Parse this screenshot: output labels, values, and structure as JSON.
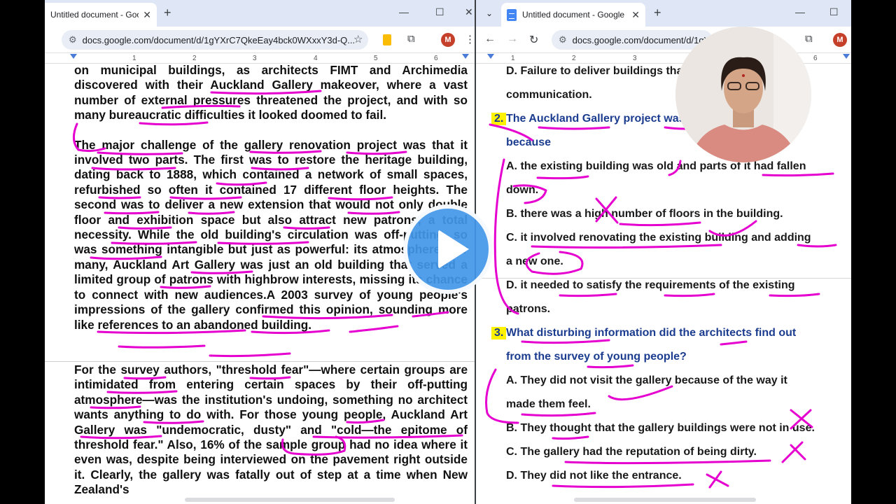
{
  "left_window": {
    "tab_title": "Untitled document - Google Docs",
    "url": "docs.google.com/document/d/1gYXrC7QkeEay4bck0WXxxY3d-Q...",
    "avatar_letter": "M",
    "ruler_numbers": [
      "1",
      "2",
      "3",
      "4",
      "5",
      "6"
    ],
    "para1": "on municipal buildings, as architects FIMT and Archimedia discovered with their Auckland Gallery makeover, where a vast number of external pressures threatened the project, and with so many bureaucratic difficulties it looked doomed to fail.",
    "para2": "The major challenge of the gallery renovation project was that it involved two parts. The first was to restore the heritage building, dating back to 1888, which contained a network of small spaces, refurbished so often it contained 17 different floor heights. The second was to deliver a new extension that would not only double floor and exhibition space but also attract new patrons, a total necessity. While the old building's circulation was off-putting, so was something intangible but just as powerful: its atmosphere. For many, Auckland Art Gallery was just an old building that served a limited group of patrons with highbrow interests, missing its chance to connect with new audiences.A 2003 survey of young people's impressions of the gallery confirmed this opinion, sounding more like references to an abandoned building.",
    "para3": "For the survey authors, \"threshold fear\"—where certain groups are intimidated from entering certain spaces by their off-putting atmosphere—was the institution's undoing, something no architect wants anything to do with. For those young people, Auckland Art Gallery was \"undemocratic, dusty\" and \"cold—the epitome of threshold fear.\" Also, 16% of the sample group had no idea where it even was, despite being interviewed on the pavement right outside it. Clearly, the gallery was fatally out of step at a time when New Zealand's"
  },
  "right_window": {
    "tab_title": "Untitled document - Google Docs",
    "url": "docs.google.com/document/d/1gY...",
    "avatar_letter": "M",
    "ruler_numbers": [
      "1",
      "2",
      "3",
      "6"
    ],
    "prev_option_line1": "D. Failure to deliver buildings that allow effective",
    "prev_option_line2": "communication.",
    "q2_num": "2.",
    "q2_line1": "The Auckland Gallery project was difficult",
    "q2_line2": "because",
    "q2_a1": "A. the existing building was old and parts of it had fallen",
    "q2_a2": "down.",
    "q2_b": "B. there was a high number of floors in the building.",
    "q2_c1": "C. it involved renovating the existing building and adding",
    "q2_c2": "a new one.",
    "q2_d1": "D. it needed to satisfy the requirements of the existing",
    "q2_d2": "patrons.",
    "q3_num": "3.",
    "q3_line1": "What disturbing information did the architects find out",
    "q3_line2": "from the survey of young people?",
    "q3_a1": "A. They did not visit the gallery because of the way it",
    "q3_a2": "made them feel.",
    "q3_b": "B. They thought that the gallery buildings were not in use.",
    "q3_c": "C. The gallery had the reputation of being dirty.",
    "q3_d": "D. They did not like the entrance."
  },
  "colors": {
    "annotation": "#e600d0",
    "question": "#1b3c8f",
    "highlight": "#fff200",
    "play": "#4296e9"
  },
  "icons": [
    "close-icon",
    "plus-icon",
    "minimize-icon",
    "maximize-icon",
    "back-icon",
    "forward-icon",
    "reload-icon",
    "site-settings-icon",
    "star-icon",
    "extensions-icon",
    "play-icon"
  ]
}
